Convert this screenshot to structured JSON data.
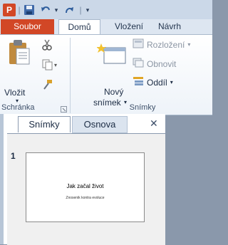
{
  "qat": {
    "app_icon": "powerpoint-logo-icon",
    "app_letter": "P",
    "save_icon": "save-icon",
    "undo_icon": "undo-icon",
    "redo_icon": "redo-icon",
    "dropdown_glyph": "▾",
    "separator": "|"
  },
  "tabs": {
    "file": "Soubor",
    "home": "Domů",
    "insert": "Vložení",
    "design_partial": "Návrh"
  },
  "ribbon": {
    "clipboard": {
      "paste_label": "Vložit",
      "paste_arrow": "▾",
      "group_label": "Schránka"
    },
    "slides": {
      "new_slide_line1": "Nový",
      "new_slide_line2": "snímek",
      "new_slide_arrow": "▾",
      "layout_label": "Rozložení",
      "layout_arrow": "▾",
      "reset_label": "Obnovit",
      "section_label": "Oddíl",
      "section_arrow": "▾",
      "group_label": "Snímky"
    }
  },
  "panel": {
    "tab_slides": "Snímky",
    "tab_outline": "Osnova",
    "close_glyph": "✕",
    "slide_number": "1",
    "slide_title": "Jak začal život",
    "slide_subtitle": "Znosenik kontra evoluce"
  },
  "colors": {
    "file_tab": "#d24726",
    "ribbon_bg": "#ffffff",
    "background": "#8a98ab"
  }
}
